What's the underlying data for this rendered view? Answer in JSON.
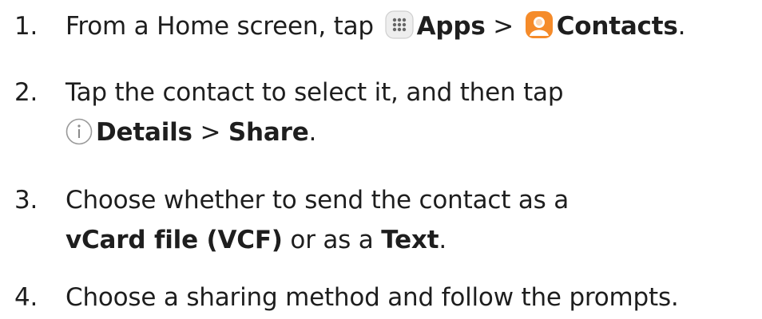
{
  "steps": [
    {
      "number": "1.",
      "text_before": "From a Home screen, tap",
      "apps_label": "Apps",
      "separator": ">",
      "contacts_label": "Contacts",
      "end": "."
    },
    {
      "number": "2.",
      "text": "Tap the contact to select it, and then tap",
      "details_label": "Details",
      "separator": ">",
      "share_label": "Share",
      "end": "."
    },
    {
      "number": "3.",
      "text": "Choose whether to send the contact as a",
      "vcard_label": "vCard file (VCF)",
      "middle": "or as a",
      "text_label": "Text",
      "end": "."
    },
    {
      "number": "4.",
      "text": "Choose a sharing method and follow the prompts."
    }
  ],
  "icons": {
    "apps": "apps-grid-icon",
    "contacts": "contacts-app-icon",
    "details": "info-icon"
  },
  "colors": {
    "text": "#1e1e1e",
    "contacts_icon": "#f58b2a",
    "apps_icon_bg": "#eeeeee"
  }
}
